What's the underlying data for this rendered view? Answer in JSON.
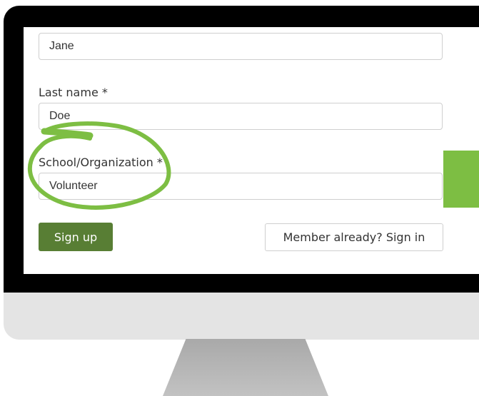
{
  "form": {
    "first_name_value": "Jane",
    "last_name_label": "Last name *",
    "last_name_value": "Doe",
    "org_label": "School/Organization *",
    "org_value": "Volunteer",
    "signup_label": "Sign up",
    "signin_label": "Member already? Sign in"
  },
  "colors": {
    "accent_green": "#7dbe43",
    "button_green": "#587e34",
    "bezel": "#000000",
    "chin": "#e4e4e4"
  }
}
